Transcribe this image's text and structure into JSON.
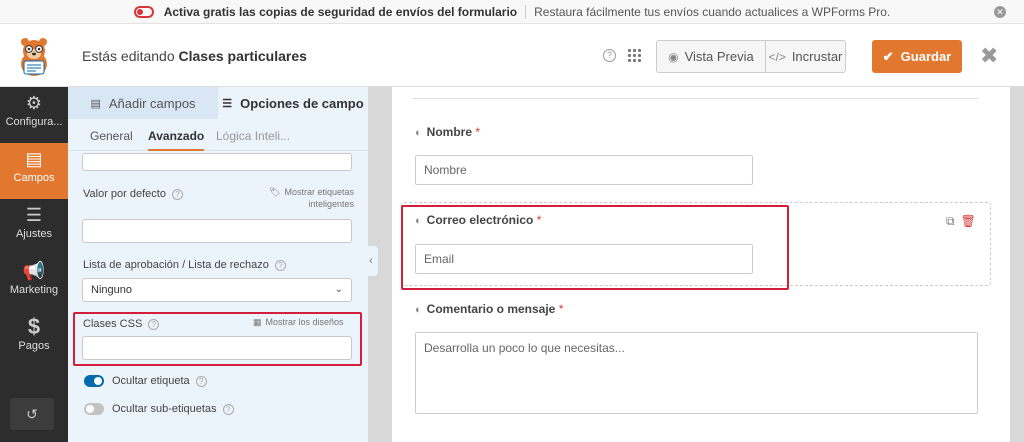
{
  "notice": {
    "bold": "Activa gratis las copias de seguridad de envíos del formulario",
    "text": "Restaura fácilmente tus envíos cuando actualices a WPForms Pro."
  },
  "header": {
    "editing_prefix": "Estás editando",
    "form_name": "Clases particulares",
    "preview_label": "Vista Previa",
    "embed_label": "Incrustar",
    "save_label": "Guardar"
  },
  "sidebar": {
    "items": [
      {
        "label": "Configura...",
        "icon": "gear-icon"
      },
      {
        "label": "Campos",
        "icon": "fields-icon"
      },
      {
        "label": "Ajustes",
        "icon": "sliders-icon"
      },
      {
        "label": "Marketing",
        "icon": "megaphone-icon"
      },
      {
        "label": "Pagos",
        "icon": "dollar-icon"
      }
    ]
  },
  "panel": {
    "tabs": [
      "Añadir campos",
      "Opciones de campo"
    ],
    "subtabs": [
      "General",
      "Avanzado",
      "Lógica Inteli..."
    ],
    "default_value_label": "Valor por defecto",
    "smart_tags_label": "Mostrar etiquetas inteligentes",
    "allow_deny_label": "Lista de aprobación / Lista de rechazo",
    "allow_deny_value": "Ninguno",
    "css_classes_label": "Clases CSS",
    "show_layouts_label": "Mostrar los diseños",
    "hide_label": "Ocultar etiqueta",
    "hide_sublabels": "Ocultar sub-etiquetas"
  },
  "form": {
    "fields": [
      {
        "label": "Nombre",
        "placeholder": "Nombre"
      },
      {
        "label": "Correo electrónico",
        "placeholder": "Email"
      },
      {
        "label": "Comentario o mensaje",
        "placeholder": "Desarrolla un poco lo que necesitas..."
      }
    ],
    "required_mark": "*"
  },
  "colors": {
    "accent": "#e27730",
    "highlight": "#d41f3c",
    "sidebar_bg": "#2d2d2d",
    "panel_bg": "#ebf3fb"
  }
}
